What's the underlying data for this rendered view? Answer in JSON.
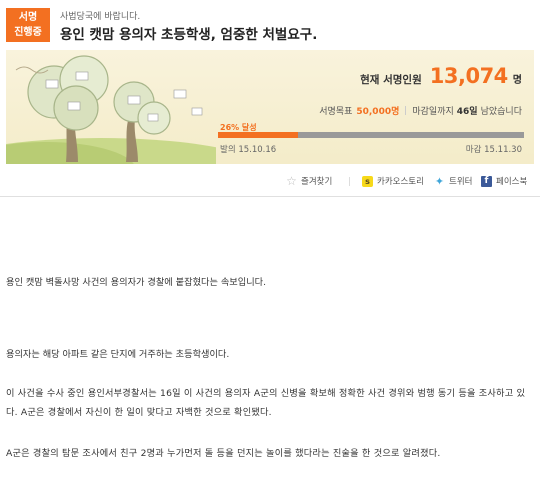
{
  "header": {
    "status_badge": [
      "서명",
      "진행중"
    ],
    "to": "사법당국에 바랍니다.",
    "title": "용인 캣맘 용의자 초등학생, 엄중한 처벌요구."
  },
  "signature": {
    "label": "현재 서명인원",
    "count": "13,074",
    "unit": "명",
    "goal_label": "서명목표",
    "goal_value": "50,000명",
    "deadline_prefix": "마감일까지",
    "days_left": "46일",
    "deadline_suffix": "남았습니다",
    "progress_label": "26% 달성",
    "progress_percent": 26,
    "start_date": "발의 15.10.16",
    "end_date": "마감 15.11.30"
  },
  "share": {
    "bookmark": "즐겨찾기",
    "kakao": "카카오스토리",
    "twitter": "트위터",
    "facebook": "페이스북"
  },
  "icons": {
    "bookmark": "star-icon",
    "kakao": "kakaostory-icon",
    "twitter": "twitter-bird-icon",
    "facebook": "facebook-icon"
  },
  "colors": {
    "accent": "#f37021",
    "banner": "#f4ecc9"
  },
  "article": {
    "p1": "용인 캣맘 벽돌사망 사건의 용의자가 경찰에 붙잡혔다는 속보입니다.",
    "p2": "용의자는 해당 아파트 같은 단지에 거주하는 초등학생이다.",
    "p3": "이 사건을 수사 중인 용인서부경찰서는 16일 이 사건의 용의자 A군의 신병을 확보해 정확한 사건 경위와 범행 동기 등을 조사하고 있다. A군은 경찰에서 자신이 한 일이 맞다고 자백한 것으로 확인됐다.",
    "p4": "A군은 경찰의 탐문 조사에서 친구 2명과 누가먼저 돌 등을 던지는 놀이를 했다라는 진술을 한 것으로 알려졌다."
  }
}
